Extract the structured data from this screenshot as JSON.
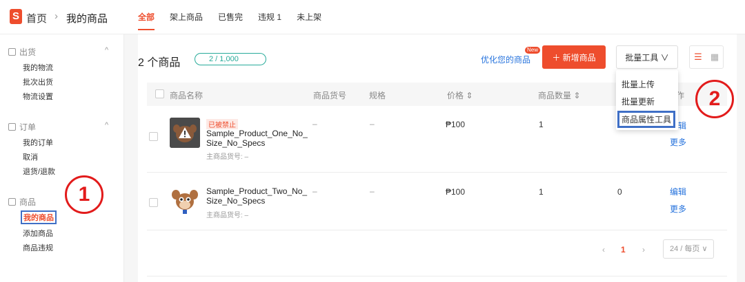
{
  "header": {
    "logo_letter": "S",
    "breadcrumb_home": "首页",
    "breadcrumb_sep": "›",
    "breadcrumb_current": "我的商品",
    "tabs": [
      {
        "label": "全部",
        "active": true
      },
      {
        "label": "架上商品"
      },
      {
        "label": "已售完"
      },
      {
        "label": "违规 1"
      },
      {
        "label": "未上架"
      }
    ]
  },
  "sidebar": {
    "sections": [
      {
        "title": "出货",
        "items": [
          "我的物流",
          "批次出货",
          "物流设置"
        ]
      },
      {
        "title": "订单",
        "items": [
          "我的订单",
          "取消",
          "退货/退款"
        ]
      },
      {
        "title": "商品",
        "items": [
          "我的商品",
          "添加商品",
          "商品违规"
        ],
        "active_item": "我的商品"
      }
    ],
    "caret": "^"
  },
  "annotations": {
    "one": "1",
    "two": "2"
  },
  "main": {
    "count_title": "2 个商品",
    "count_pill": "2 / 1,000",
    "optimize_link": "优化您的商品",
    "new_badge": "New",
    "add_button": "＋ 新增商品",
    "bulk_button": "批量工具 ∨",
    "view_list_icon": "☰",
    "view_grid_icon": "▦",
    "table": {
      "headers": {
        "name": "商品名称",
        "sku": "商品货号",
        "variation": "规格",
        "price": "价格 ⇕",
        "stock": "商品数量 ⇕",
        "actions": "作"
      },
      "rows": [
        {
          "banned_label": "已被禁止",
          "name": "Sample_Product_One_No_Size_No_Specs",
          "parent_sku": "主商品货号: –",
          "sku": "–",
          "variation": "–",
          "price": "₱100",
          "stock": "1",
          "sales": "",
          "edit": "编辑",
          "more": "更多"
        },
        {
          "banned_label": "",
          "name": "Sample_Product_Two_No_Size_No_Specs",
          "parent_sku": "主商品货号: –",
          "sku": "–",
          "variation": "–",
          "price": "₱100",
          "stock": "1",
          "sales": "0",
          "edit": "编辑",
          "more": "更多"
        }
      ]
    },
    "pagination": {
      "prev": "‹",
      "current_page": "1",
      "next": "›",
      "page_size": "24 / 每页 ∨"
    }
  },
  "bulk_dropdown": {
    "items": [
      "批量上传",
      "批量更新",
      "商品属性工具"
    ],
    "highlighted": "商品属性工具"
  },
  "colors": {
    "accent": "#ee4d2d",
    "link": "#2673dd",
    "teal": "#26aa99",
    "annotation_red": "#e21b1b",
    "highlight_blue": "#3f6fc6"
  }
}
